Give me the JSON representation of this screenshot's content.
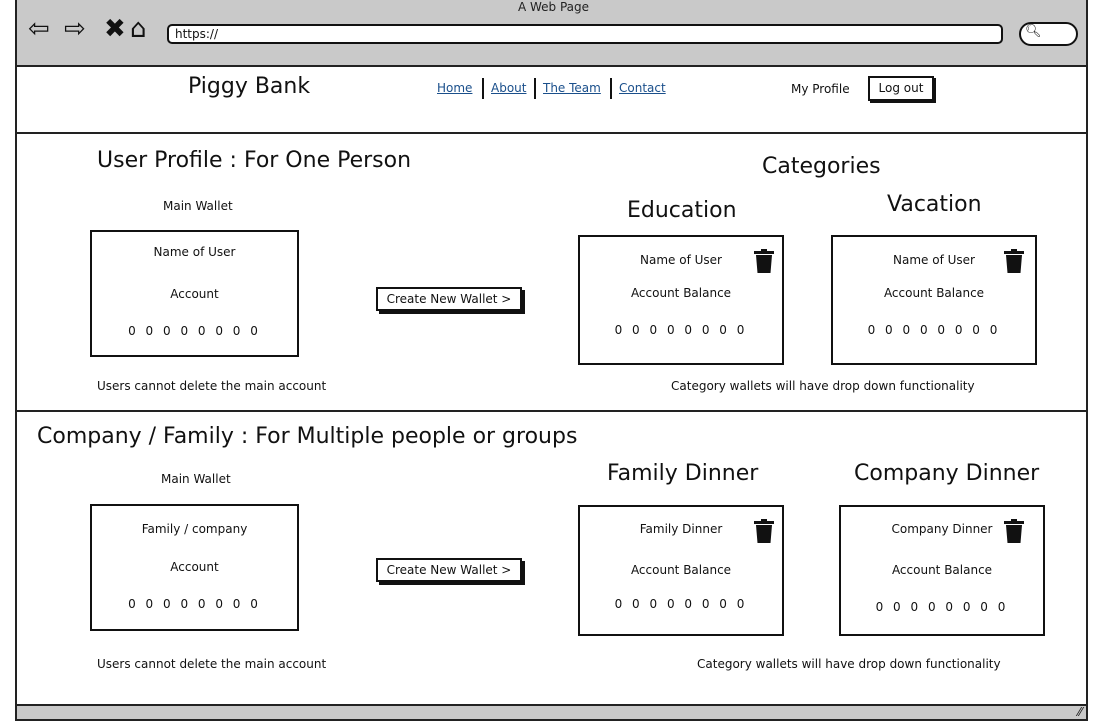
{
  "window": {
    "title": "A Web Page",
    "url": "https://"
  },
  "header": {
    "brand": "Piggy Bank",
    "nav": [
      "Home",
      "About",
      "The Team",
      "Contact"
    ],
    "my_profile": "My Profile",
    "logout": "Log out"
  },
  "user_section": {
    "title": "User Profile : For One Person",
    "main_wallet_label": "Main Wallet",
    "main_wallet": {
      "name": "Name of User",
      "account": "Account",
      "balance": "0 0 0 0 0 0 0 0"
    },
    "create_button": "Create New Wallet >",
    "note_left": "Users cannot delete the main account",
    "categories_title": "Categories",
    "categories": [
      {
        "title": "Education",
        "name": "Name of User",
        "account": "Account Balance",
        "balance": "0 0 0 0 0 0 0 0"
      },
      {
        "title": "Vacation",
        "name": "Name of User",
        "account": "Account Balance",
        "balance": "0 0 0 0 0 0 0 0"
      }
    ],
    "note_right": "Category wallets will have drop down functionality"
  },
  "company_section": {
    "title": "Company / Family : For Multiple people or groups",
    "main_wallet_label": "Main Wallet",
    "main_wallet": {
      "name": "Family / company",
      "account": "Account",
      "balance": "0 0 0 0 0 0 0 0"
    },
    "create_button": "Create New Wallet >",
    "note_left": "Users cannot delete the main account",
    "categories": [
      {
        "title": "Family Dinner",
        "name": "Family Dinner",
        "account": "Account Balance",
        "balance": "0 0 0 0 0 0 0 0"
      },
      {
        "title": "Company Dinner",
        "name": "Company Dinner",
        "account": "Account Balance",
        "balance": "0 0 0 0 0 0 0 0"
      }
    ],
    "note_right": "Category wallets will have drop down functionality"
  }
}
